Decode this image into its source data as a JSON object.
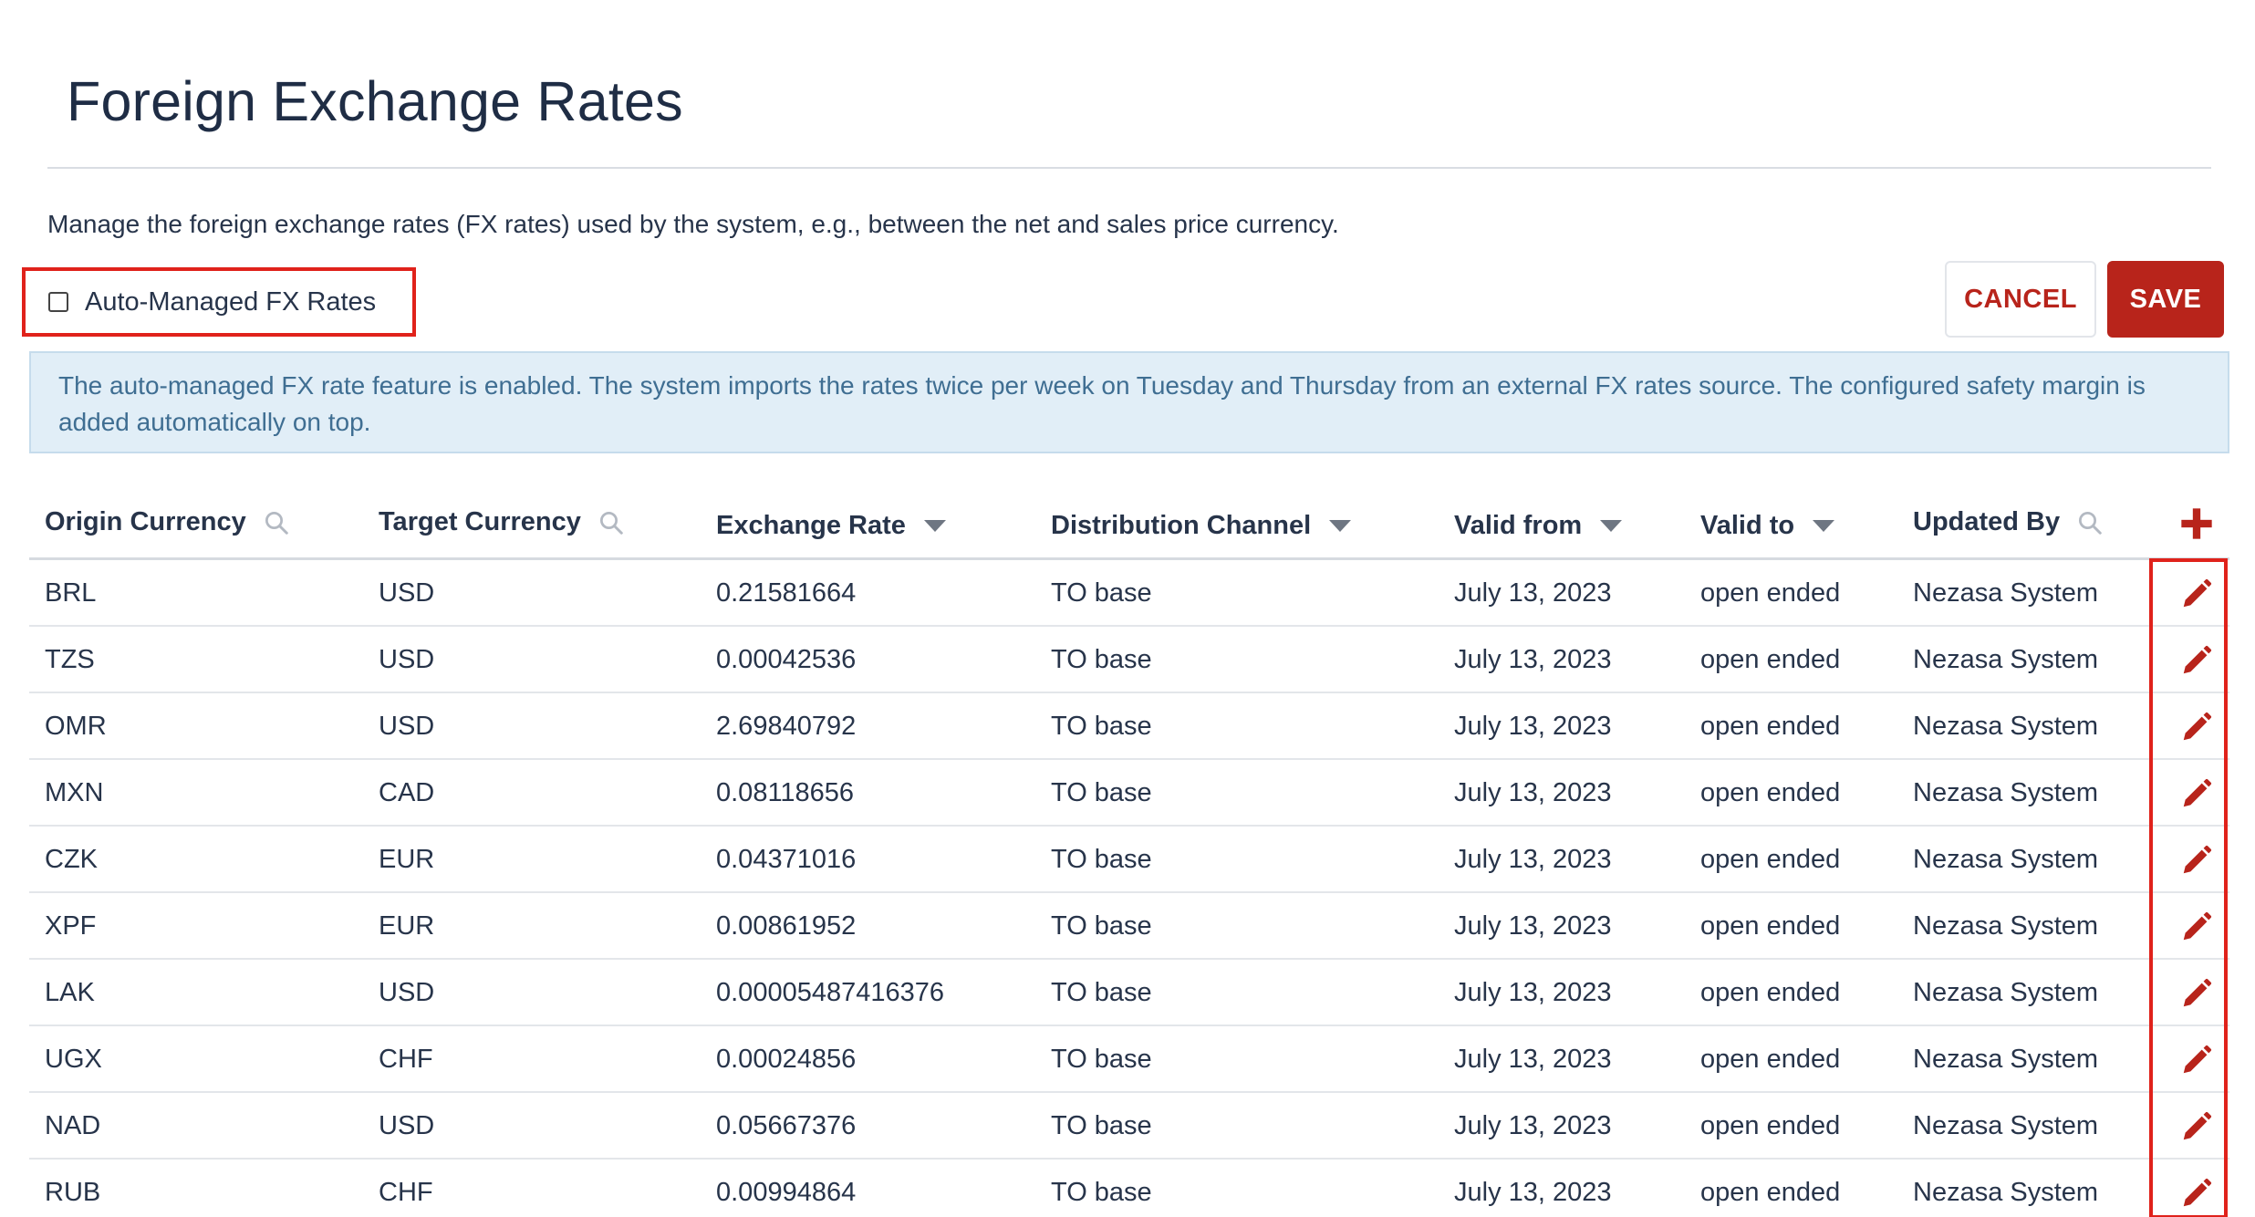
{
  "page": {
    "title": "Foreign Exchange Rates",
    "description": "Manage the foreign exchange rates (FX rates) used by the system, e.g., between the net and sales price currency."
  },
  "auto_managed": {
    "label": "Auto-Managed FX Rates",
    "checked": false
  },
  "actions": {
    "cancel_label": "CANCEL",
    "save_label": "SAVE"
  },
  "info_banner": {
    "text": "The auto-managed FX rate feature is enabled. The system imports the rates twice per week on Tuesday and Thursday from an external FX rates source. The configured safety margin is added automatically on top."
  },
  "table": {
    "columns": {
      "origin": "Origin Currency",
      "target": "Target Currency",
      "rate": "Exchange Rate",
      "channel": "Distribution Channel",
      "valid_from": "Valid from",
      "valid_to": "Valid to",
      "updated_by": "Updated By"
    },
    "rows": [
      {
        "origin": "BRL",
        "target": "USD",
        "rate": "0.21581664",
        "channel": "TO base",
        "valid_from": "July 13, 2023",
        "valid_to": "open ended",
        "updated_by": "Nezasa System"
      },
      {
        "origin": "TZS",
        "target": "USD",
        "rate": "0.00042536",
        "channel": "TO base",
        "valid_from": "July 13, 2023",
        "valid_to": "open ended",
        "updated_by": "Nezasa System"
      },
      {
        "origin": "OMR",
        "target": "USD",
        "rate": "2.69840792",
        "channel": "TO base",
        "valid_from": "July 13, 2023",
        "valid_to": "open ended",
        "updated_by": "Nezasa System"
      },
      {
        "origin": "MXN",
        "target": "CAD",
        "rate": "0.08118656",
        "channel": "TO base",
        "valid_from": "July 13, 2023",
        "valid_to": "open ended",
        "updated_by": "Nezasa System"
      },
      {
        "origin": "CZK",
        "target": "EUR",
        "rate": "0.04371016",
        "channel": "TO base",
        "valid_from": "July 13, 2023",
        "valid_to": "open ended",
        "updated_by": "Nezasa System"
      },
      {
        "origin": "XPF",
        "target": "EUR",
        "rate": "0.00861952",
        "channel": "TO base",
        "valid_from": "July 13, 2023",
        "valid_to": "open ended",
        "updated_by": "Nezasa System"
      },
      {
        "origin": "LAK",
        "target": "USD",
        "rate": "0.00005487416376",
        "channel": "TO base",
        "valid_from": "July 13, 2023",
        "valid_to": "open ended",
        "updated_by": "Nezasa System"
      },
      {
        "origin": "UGX",
        "target": "CHF",
        "rate": "0.00024856",
        "channel": "TO base",
        "valid_from": "July 13, 2023",
        "valid_to": "open ended",
        "updated_by": "Nezasa System"
      },
      {
        "origin": "NAD",
        "target": "USD",
        "rate": "0.05667376",
        "channel": "TO base",
        "valid_from": "July 13, 2023",
        "valid_to": "open ended",
        "updated_by": "Nezasa System"
      },
      {
        "origin": "RUB",
        "target": "CHF",
        "rate": "0.00994864",
        "channel": "TO base",
        "valid_from": "July 13, 2023",
        "valid_to": "open ended",
        "updated_by": "Nezasa System"
      }
    ]
  },
  "icons": {
    "search": "search-icon",
    "sort": "caret-down-icon",
    "add": "plus-icon",
    "edit": "pencil-icon"
  },
  "colors": {
    "accent": "#b8241b",
    "highlight": "#e0221b",
    "banner_bg": "#e1eef7",
    "banner_text": "#3f6e92"
  }
}
